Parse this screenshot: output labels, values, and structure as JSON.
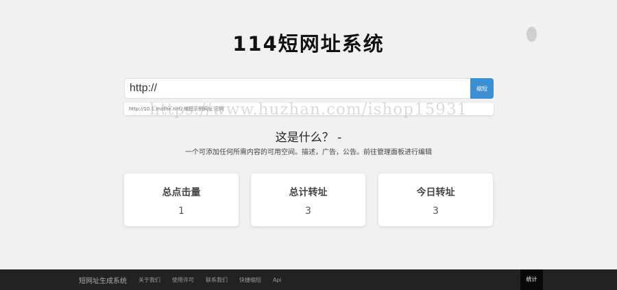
{
  "site": {
    "title": "114短网址系统"
  },
  "form": {
    "url_value": "http://",
    "submit_label": "缩短"
  },
  "example": {
    "text": "http://10.1.mathe.net/  缩短示例网址 示例"
  },
  "about": {
    "heading": "这是什么？ -",
    "description": "一个可添加任何所需内容的可用空间。描述，广告，公告。前往管理面板进行编辑"
  },
  "stats": [
    {
      "label": "总点击量",
      "value": "1"
    },
    {
      "label": "总计转址",
      "value": "3"
    },
    {
      "label": "今日转址",
      "value": "3"
    }
  ],
  "footer": {
    "brand": "短网址生成系统",
    "links": [
      "关于我们",
      "使用许可",
      "联系我们",
      "快捷缩短",
      "Api"
    ],
    "stats_label": "统计"
  },
  "watermark": "https://www.huzhan.com/ishop15931"
}
